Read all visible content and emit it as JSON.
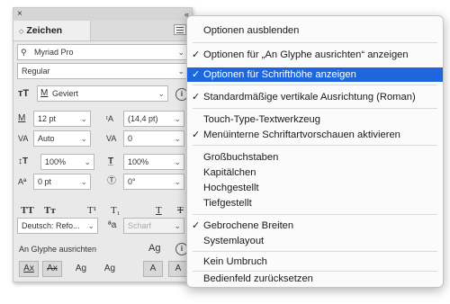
{
  "panel": {
    "close_glyph": "×",
    "collapse_glyph": "‹‹",
    "tab_arrow": "◇",
    "tab_label": "Zeichen",
    "font_family": "Myriad Pro",
    "font_style": "Regular",
    "kerning_method": "Geviert",
    "font_size": "12 pt",
    "leading": "(14,4 pt)",
    "kerning": "Auto",
    "tracking": "0",
    "vertical_scale": "100%",
    "horizontal_scale": "100%",
    "baseline_shift": "0 pt",
    "rotation": "0°",
    "type_buttons": [
      "TT",
      "Tт",
      "T¹",
      "T₁",
      "T",
      "T"
    ],
    "language": "Deutsch: Refo...",
    "aa_label": "ªa",
    "antialias": "Scharf",
    "snap_label": "An Glyphe ausrichten",
    "snap_buttons": [
      "Ax",
      "Ax",
      "Ag",
      "Ag",
      "A",
      "A"
    ]
  },
  "menu": {
    "items": [
      {
        "label": "Optionen ausblenden",
        "checked": false
      },
      {
        "label": "Optionen für „An Glyphe ausrichten“ anzeigen",
        "checked": true
      },
      {
        "label": "Optionen für Schrifthöhe anzeigen",
        "checked": true
      },
      {
        "label": "Standardmäßige vertikale Ausrichtung (Roman)",
        "checked": true
      },
      {
        "label": "Touch-Type-Textwerkzeug",
        "checked": false
      },
      {
        "label": "Menüinterne Schriftartvorschauen aktivieren",
        "checked": true
      },
      {
        "label": "Großbuchstaben",
        "checked": false
      },
      {
        "label": "Kapitälchen",
        "checked": false
      },
      {
        "label": "Hochgestellt",
        "checked": false
      },
      {
        "label": "Tiefgestellt",
        "checked": false
      },
      {
        "label": "Gebrochene Breiten",
        "checked": true
      },
      {
        "label": "Systemlayout",
        "checked": false
      },
      {
        "label": "Kein Umbruch",
        "checked": false
      },
      {
        "label": "Bedienfeld zurücksetzen",
        "checked": false
      }
    ],
    "check_glyph": "✓",
    "highlight_color": "#1d66dd"
  }
}
